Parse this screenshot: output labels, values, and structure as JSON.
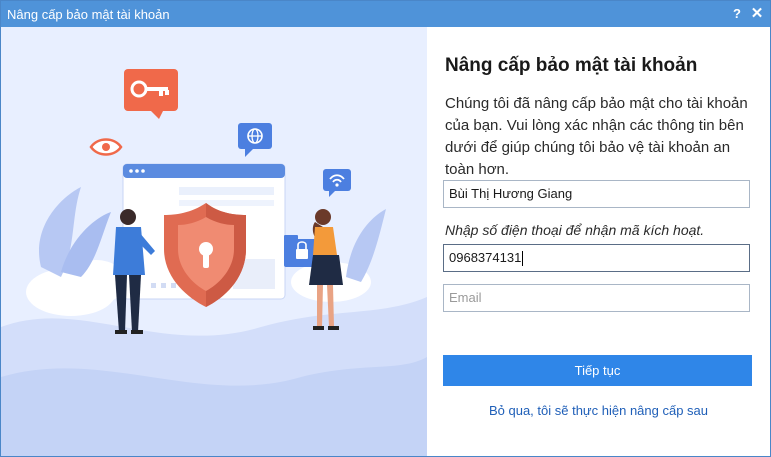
{
  "window": {
    "title": "Nâng cấp bảo mật tài khoản",
    "help_label": "?",
    "close_label": "✕"
  },
  "illustration": {
    "icons": [
      "key-icon",
      "eye-icon",
      "globe-icon",
      "wifi-icon",
      "shield-lock-icon",
      "folder-lock-icon"
    ]
  },
  "form": {
    "heading": "Nâng cấp bảo mật tài khoản",
    "description": "Chúng tôi đã nâng cấp bảo mật cho tài khoản của bạn. Vui lòng xác nhận các thông tin bên dưới để giúp chúng tôi bảo vệ tài khoản an toàn hơn.",
    "name_value": "Bùi Thị Hương Giang",
    "phone_hint": "Nhập số điện thoại để nhận mã kích hoạt.",
    "phone_value": "0968374131",
    "email_placeholder": "Email",
    "continue_label": "Tiếp tục",
    "skip_label": "Bỏ qua, tôi sẽ thực hiện nâng cấp sau"
  },
  "colors": {
    "titlebar": "#4f93d9",
    "illustration_bg": "#e8efff",
    "accent_button": "#2f86e8",
    "link": "#1f5fb8",
    "shield": "#e06b52"
  }
}
